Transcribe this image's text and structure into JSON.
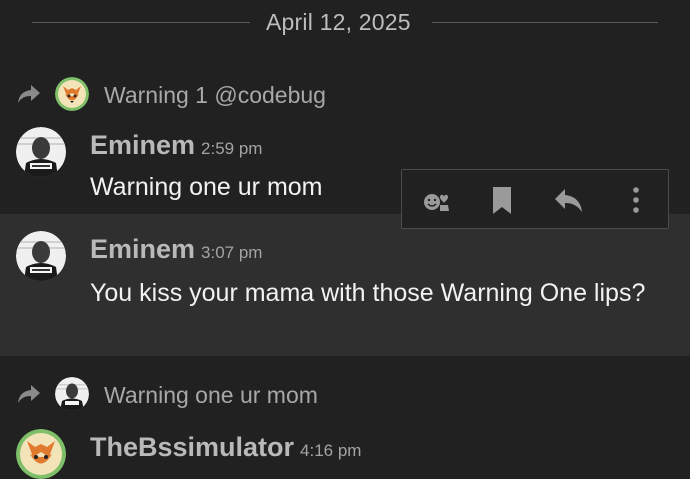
{
  "date_divider": {
    "label": "April 12, 2025"
  },
  "reply_context_1": {
    "text": "Warning 1 @codebug",
    "avatar_icon": "fox-avatar-icon"
  },
  "messages": [
    {
      "username": "Eminem",
      "time": "2:59 pm",
      "text": "Warning one ur mom",
      "avatar_icon": "eminem-avatar"
    },
    {
      "username": "Eminem",
      "time": "3:07 pm",
      "text": "You kiss your mama with those Warning One lips?",
      "avatar_icon": "eminem-avatar"
    },
    {
      "username": "TheBssimulator",
      "time": "4:16 pm",
      "text": "",
      "avatar_icon": "fox-avatar-icon"
    }
  ],
  "reply_context_2": {
    "text": "Warning one ur mom",
    "avatar_icon": "eminem-avatar"
  },
  "toolbar": {
    "icons": [
      "react-icon",
      "bookmark-icon",
      "reply-icon",
      "more-icon"
    ]
  },
  "colors": {
    "background": "#212121",
    "highlight": "#2f2f2f",
    "username": "#b9b9b9",
    "body_text": "#f2f2f2",
    "muted_text": "#a8a8a8"
  }
}
